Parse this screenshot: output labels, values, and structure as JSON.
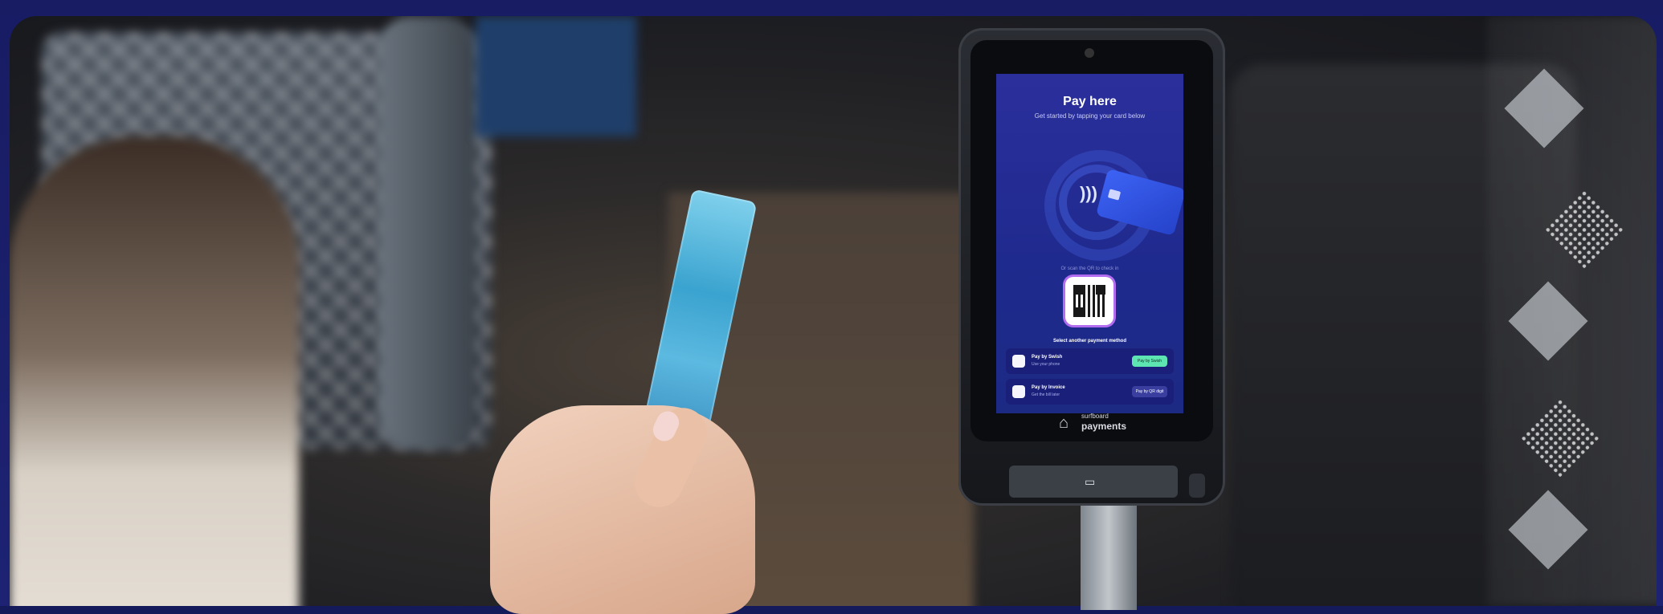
{
  "screen": {
    "title": "Pay here",
    "subtitle": "Get started by tapping your card below",
    "qr_label": "Or scan the QR to check in",
    "alternative_label": "Select another payment method",
    "options": [
      {
        "title": "Pay by Swish",
        "desc": "Use your phone",
        "button": "Pay by Swish"
      },
      {
        "title": "Pay by Invoice",
        "desc": "Get the bill later",
        "button": "Pay by QR digit"
      }
    ]
  },
  "brand": {
    "line1": "surfboard",
    "line2": "payments"
  },
  "icons": {
    "nfc": "contactless-icon",
    "card": "card-icon",
    "qr": "qr-code-icon",
    "swish": "swish-icon",
    "invoice": "invoice-icon",
    "brand": "surfboard-logo-icon",
    "reader": "card-reader-icon"
  },
  "colors": {
    "background": "#181c63",
    "screen": "#1f2a8e",
    "accent": "#b26cf0",
    "success": "#5ee6b2"
  }
}
